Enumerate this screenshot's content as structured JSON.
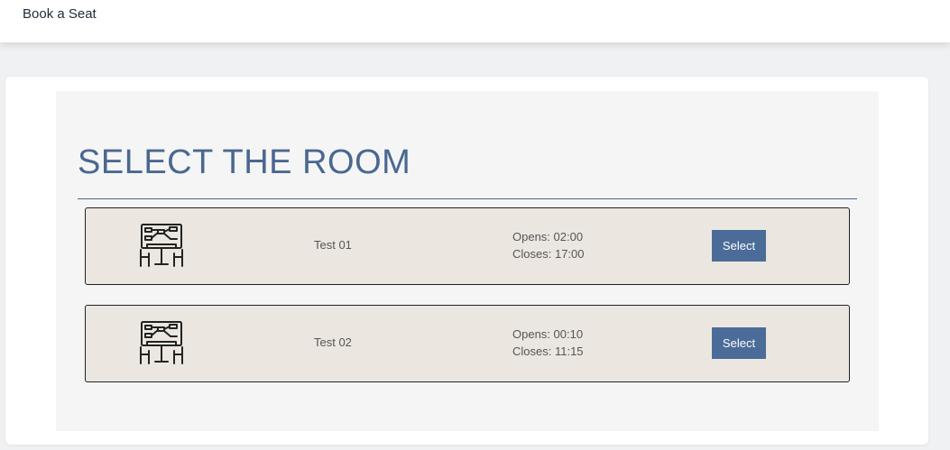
{
  "header": {
    "brand": "Book a Seat"
  },
  "page": {
    "title": "SELECT THE ROOM"
  },
  "rooms": [
    {
      "name": "Test 01",
      "opens": "Opens: 02:00",
      "closes": "Closes: 17:00",
      "button": "Select",
      "icon": "meeting-room-icon"
    },
    {
      "name": "Test 02",
      "opens": "Opens: 00:10",
      "closes": "Closes: 11:15",
      "button": "Select",
      "icon": "meeting-room-icon"
    }
  ],
  "colors": {
    "accent": "#4a6890",
    "button": "#4b6c98",
    "row_bg": "#ebe7e0"
  }
}
